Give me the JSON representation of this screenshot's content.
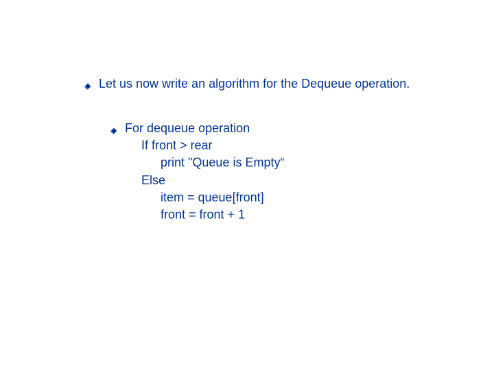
{
  "main": {
    "intro": "Let us now write an algorithm for the Dequeue operation."
  },
  "algo": {
    "title": "For dequeue operation",
    "l1": "If front > rear",
    "l2": "print \"Queue is Empty“",
    "l3": "Else",
    "l4": "item = queue[front]",
    "l5": "front = front + 1"
  }
}
